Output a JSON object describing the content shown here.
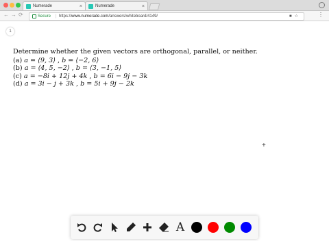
{
  "browser": {
    "tabs": [
      {
        "title": "Numerade",
        "active": true
      },
      {
        "title": "Numerade",
        "active": false
      }
    ],
    "secure_label": "Secure",
    "url_scheme": "https://",
    "url_host": "www.numerade.com",
    "url_path": "/answers/whiteboard/4149/"
  },
  "whiteboard": {
    "page_number": "1",
    "question": "Determine whether the given vectors are orthogonal, parallel, or neither.",
    "items": [
      {
        "label": "(a)",
        "a": "a = ⟨9, 3⟩",
        "b": "b = ⟨−2, 6⟩"
      },
      {
        "label": "(b)",
        "a": "a = ⟨4, 5, −2⟩",
        "b": "b = ⟨3, −1, 5⟩"
      },
      {
        "label": "(c)",
        "a": "a = −8i + 12j + 4k",
        "b": "b = 6i − 9j − 3k"
      },
      {
        "label": "(d)",
        "a": "a = 3i − j + 3k",
        "b": "b = 5i + 9j − 2k"
      }
    ]
  },
  "toolbar": {
    "tools": [
      "undo-icon",
      "redo-icon",
      "pointer-icon",
      "pen-icon",
      "add-icon",
      "eraser-icon",
      "text-icon"
    ],
    "text_tool_glyph": "A",
    "colors": [
      "#000000",
      "#ff0000",
      "#008a00",
      "#0000ff"
    ]
  }
}
